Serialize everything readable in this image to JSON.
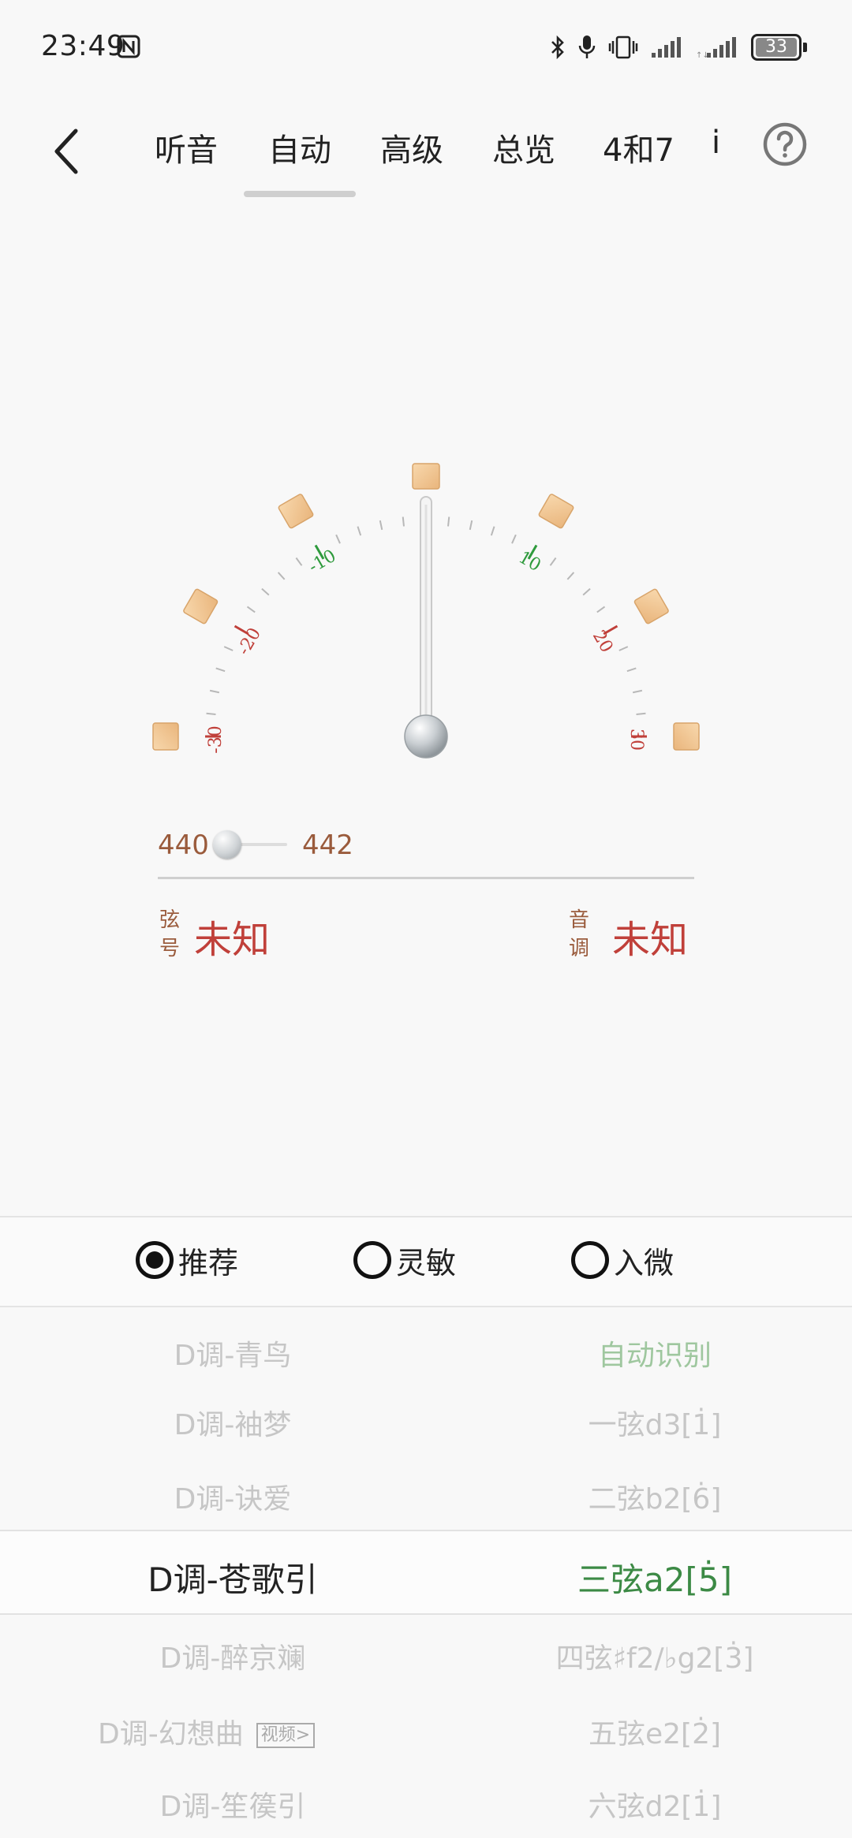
{
  "status_bar": {
    "time": "23:49",
    "battery": "33",
    "icons": [
      "nfc-icon",
      "bluetooth-icon",
      "microphone-icon",
      "vibrate-icon",
      "signal-icon",
      "signal-icon",
      "battery-icon"
    ]
  },
  "tabs": [
    {
      "label": "听音"
    },
    {
      "label": "自动"
    },
    {
      "label": "高级"
    },
    {
      "label": "总览"
    },
    {
      "label": "4和7"
    },
    {
      "label": "i"
    }
  ],
  "active_tab": "自动",
  "gauge": {
    "labels": {
      "m30": "-30",
      "m20": "-20",
      "m10": "-10",
      "p10": "10",
      "p20": "20",
      "p30": "30"
    },
    "needle_cents": 0,
    "colors": {
      "red": "#c0403a",
      "green": "#2e9a3c",
      "pad": "#f2c794"
    }
  },
  "reference": {
    "min": "440",
    "max": "442",
    "value_fraction": 0.0
  },
  "readouts": {
    "string_label_1": "弦",
    "string_label_2": "号",
    "string_value": "未知",
    "tone_label_1": "音",
    "tone_label_2": "调",
    "tone_value": "未知"
  },
  "modes": [
    {
      "label": "推荐",
      "selected": true
    },
    {
      "label": "灵敏",
      "selected": false
    },
    {
      "label": "入微",
      "selected": false
    }
  ],
  "picker": {
    "rows": [
      {
        "song": "D调-青鸟",
        "string": "自动识别"
      },
      {
        "song": "D调-袖梦",
        "string": "一弦d3[1̇]"
      },
      {
        "song": "D调-诀爱",
        "string": "二弦b2[6̇]"
      },
      {
        "song": "D调-苍歌引",
        "string": "三弦a2[5̇]"
      },
      {
        "song": "D调-醉京斓",
        "string": "四弦♯f2/♭g2[3̇]"
      },
      {
        "song": "D调-幻想曲",
        "string": "五弦e2[2̇]",
        "badge": "视频>"
      },
      {
        "song": "D调-笙篌引",
        "string": "六弦d2[1̇]"
      }
    ],
    "selected_index": 3
  }
}
